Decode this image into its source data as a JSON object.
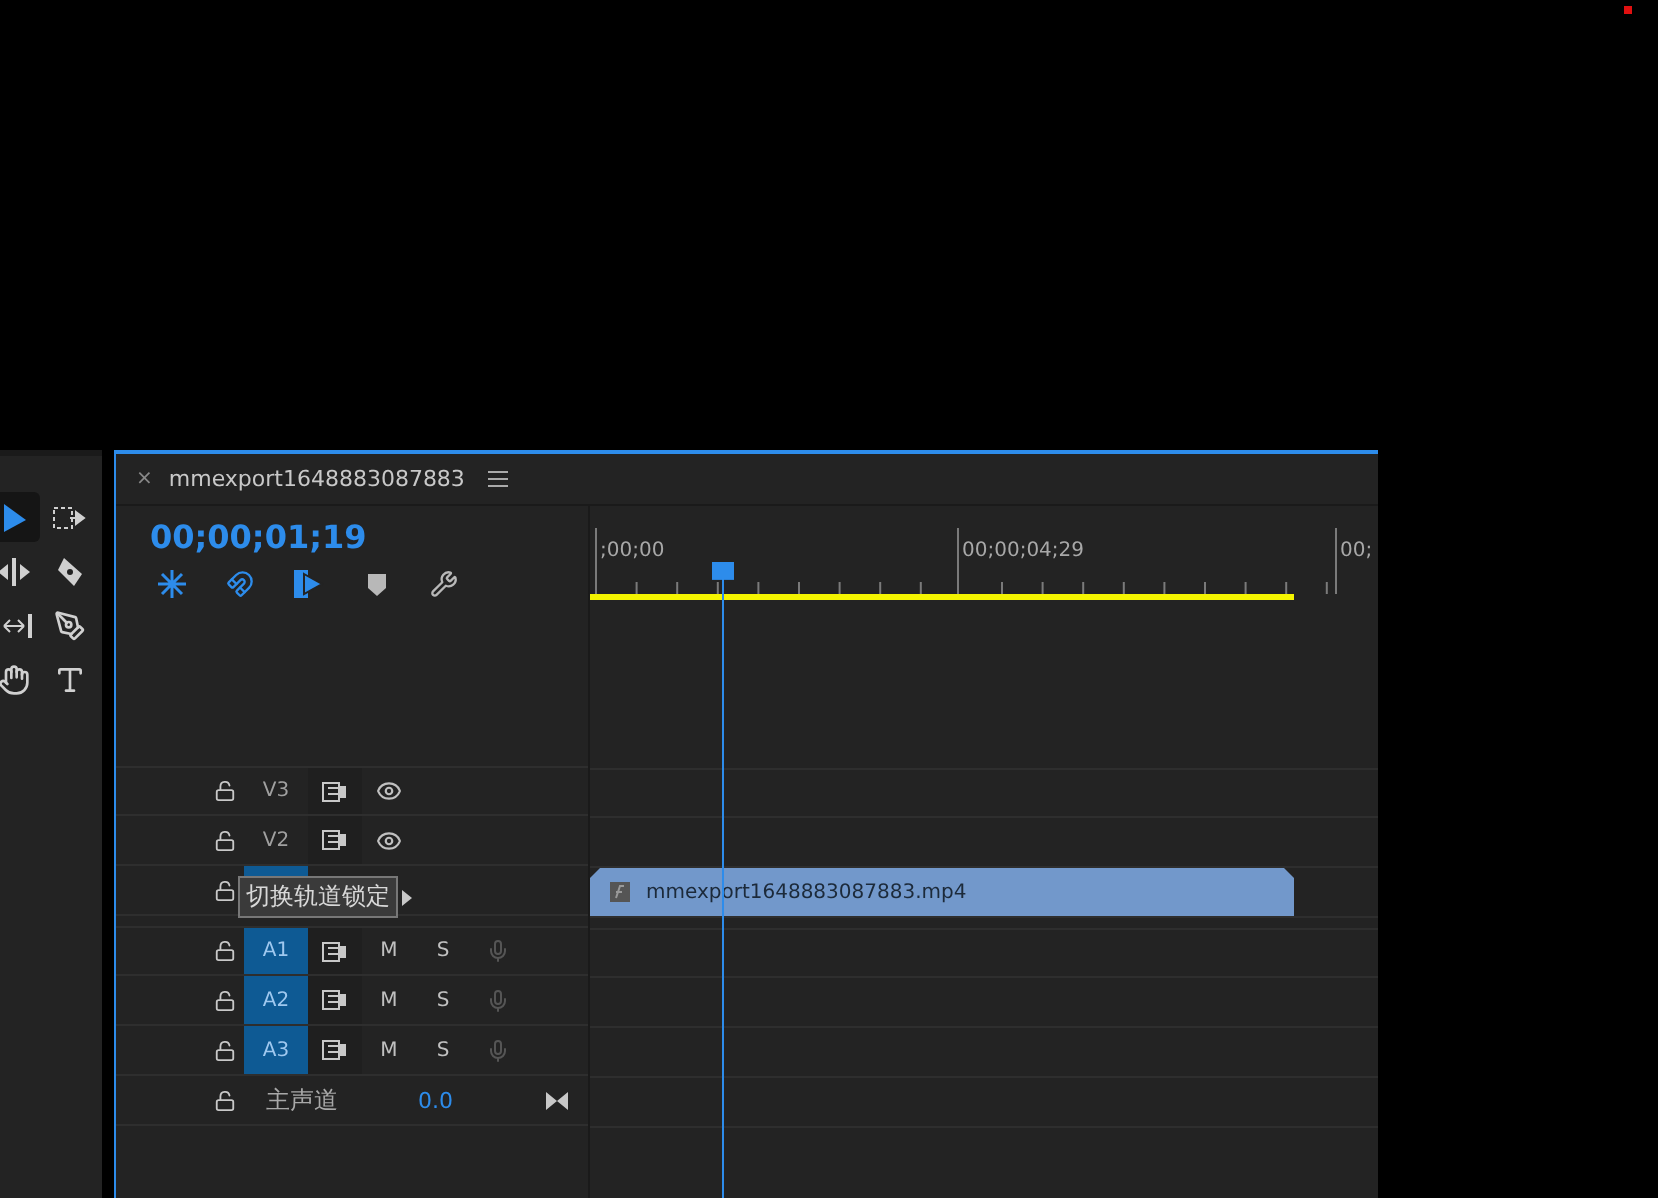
{
  "tools": [
    {
      "kind": "selection",
      "selected": true
    },
    {
      "kind": "track-select",
      "selected": false
    },
    {
      "kind": "ripple",
      "selected": false
    },
    {
      "kind": "razor",
      "selected": false
    },
    {
      "kind": "slip",
      "selected": false
    },
    {
      "kind": "pen",
      "selected": false
    },
    {
      "kind": "hand",
      "selected": false
    },
    {
      "kind": "type",
      "selected": false
    }
  ],
  "sequence": {
    "close": "×",
    "tab_title": "mmexport1648883087883",
    "timecode": "00;00;01;19"
  },
  "toolbar": [
    {
      "kind": "nest",
      "on": true
    },
    {
      "kind": "snap",
      "on": true
    },
    {
      "kind": "linked",
      "on": true
    },
    {
      "kind": "marker",
      "on": false
    },
    {
      "kind": "settings",
      "on": false
    }
  ],
  "ruler": {
    "labels": [
      ";00;00",
      "00;00;04;29",
      "00;"
    ]
  },
  "video_tracks": [
    {
      "label": "V3",
      "locked": false,
      "targeted": false,
      "visible": true
    },
    {
      "label": "V2",
      "locked": false,
      "targeted": false,
      "visible": true
    },
    {
      "locked": false,
      "targeted": true,
      "clip": {
        "name": "mmexport1648883087883.mp4"
      }
    }
  ],
  "tooltip": "切换轨道锁定",
  "audio_tracks": [
    {
      "label": "A1",
      "locked": false,
      "targeted": true,
      "mute": "M",
      "solo": "S"
    },
    {
      "label": "A2",
      "locked": false,
      "targeted": true,
      "mute": "M",
      "solo": "S"
    },
    {
      "label": "A3",
      "locked": false,
      "targeted": true,
      "mute": "M",
      "solo": "S"
    }
  ],
  "master": {
    "label": "主声道",
    "locked": false,
    "value": "0.0"
  }
}
